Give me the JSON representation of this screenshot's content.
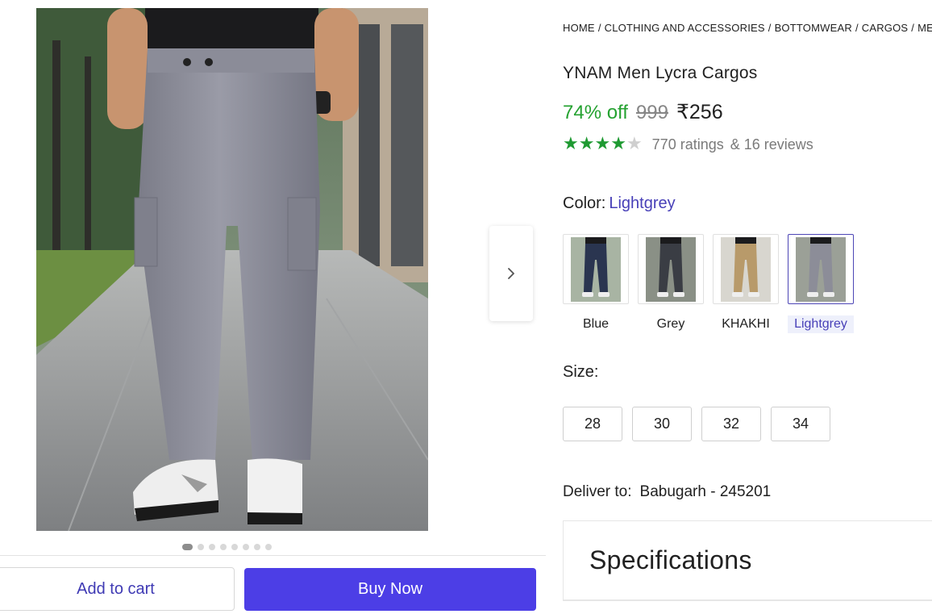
{
  "breadcrumb": [
    "Home",
    "Clothing and Accessories",
    "Bottomwear",
    "Cargos",
    "Me"
  ],
  "product": {
    "title": "YNAM Men Lycra Cargos",
    "discount": "74% off",
    "mrp": "999",
    "price": "₹256",
    "rating_value": 4,
    "rating_max": 5,
    "ratings_text": "770 ratings",
    "reviews_text": "& 16 reviews"
  },
  "gallery": {
    "slide_count": 8,
    "active_index": 0,
    "next_icon": "chevron-right-icon"
  },
  "color": {
    "label": "Color:",
    "selected": "Lightgrey",
    "options": [
      {
        "label": "Blue",
        "pant": "#2a3550",
        "bg": "#a8b4a3"
      },
      {
        "label": "Grey",
        "pant": "#3a3d44",
        "bg": "#8a9086"
      },
      {
        "label": "KHAKHI",
        "pant": "#b89a6a",
        "bg": "#d8d6cf"
      },
      {
        "label": "Lightgrey",
        "pant": "#8c8d98",
        "bg": "#9ba097"
      }
    ]
  },
  "size": {
    "label": "Size:",
    "options": [
      "28",
      "30",
      "32",
      "34"
    ]
  },
  "delivery": {
    "label": "Deliver to:",
    "location": "Babugarh - 245201"
  },
  "specifications": {
    "title": "Specifications"
  },
  "actions": {
    "add_to_cart": "Add to cart",
    "buy_now": "Buy Now"
  },
  "colors": {
    "accent": "#4c3ee6",
    "link": "#4840b8",
    "discount": "#25a231",
    "star": "#1f9a32"
  }
}
